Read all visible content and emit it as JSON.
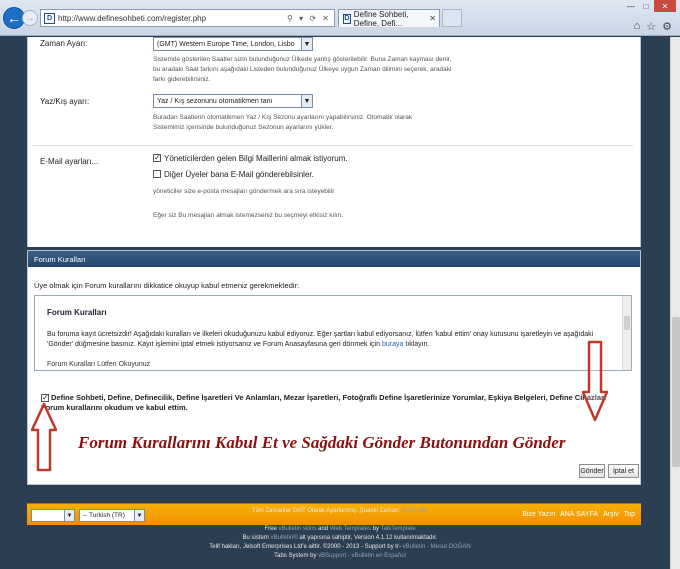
{
  "browser": {
    "url": "http://www.definesohbeti.com/register.php",
    "address_controls": "⚲ ▾ ⟳ ✕",
    "tab_title": "Define Sohbeti, Define, Defi...",
    "tab_close": "✕",
    "favicon": "D",
    "back": "←",
    "forward": "→",
    "window_controls": [
      "—",
      "□",
      "✕"
    ],
    "tool_icons": [
      "⌂",
      "☆",
      "⚙"
    ]
  },
  "settings": {
    "timezone_label": "Zaman Ayarı:",
    "timezone_value": "(GMT) Western Europe Time, London, Lisbo",
    "timezone_help": "Sistemde gösterilen Saatler sizin bulunduğunuz Ülkede yanlış gösterilebilir. Buna Zaman kayması denir, bu aradaki Saat farkını aşağıdaki Listeden bulunduğunuz Ülkeye uygun Zaman dilimini seçerek, aradaki farkı giderebilirsiniz.",
    "dst_label": "Yaz/Kış ayarı:",
    "dst_value": "Yaz / Kış sezonunu otomatikmen tanı",
    "dst_help": "Buradan Saatlerin otomatikmen Yaz / Kış Sezonu ayarlarını yapabilirsiniz. Otomatik olarak Sistemimiz içerisinde bulunduğunuz Sezonun ayarlarını yükler.",
    "email_label": "E-Mail ayarları...",
    "email_opt1": "Yöneticilerden gelen Bilgi Maillerini almak istiyorum.",
    "email_opt2": "Diğer Üyeler bana E-Mail gönderebilsinler.",
    "email_help1": "yöneticiler size e-posta mesajları göndermek ara sıra isteyebilir",
    "email_help2": "Eğer siz Bu mesajları almak istemezseniz bu seçmeyi etkisiz kılın."
  },
  "rules": {
    "header": "Forum Kuralları",
    "intro": "Üye olmak için Forum kurallarını dikkatice okuyup kabul etmeniz gerekmektedir:",
    "box_title": "Forum Kuralları",
    "box_body": "Bu foruma kayıt ücretsizdir! Aşağıdaki kuralları ve ilkeleri okuduğunuzu kabul ediyoruz. Eğer şartları kabul ediyorsanız, lütfen 'kabul ettim' onay kutusunu işaretleyin ve aşağıdaki 'Gönder' düğmesine basınız. Kayıt işlemini iptal etmek istiyorsanız ve Forum Anasayfasına geri dönmek için",
    "box_link": "buraya",
    "box_body_end": "tıklayın.",
    "box_sub": "Forum Kuralları Lütfen Okuyunuz",
    "agree_text": "Define Sohbeti, Define, Definecilik, Define İşaretleri Ve Anlamları, Mezar İşaretleri, Fotoğraflı Define İşaretlerinize Yorumlar, Eşkiya Belgeleri, Define Cihazları Forum kurallarını okudum ve kabul ettim."
  },
  "overlay_caption": "Forum Kurallarını Kabul Et ve Sağdaki Gönder Butonundan Gönder",
  "buttons": {
    "submit": "Gönder",
    "cancel": "İptal et"
  },
  "bottom_bar": {
    "style_select": "",
    "lang_select": "-- Turkish (TR)",
    "links": [
      "Bize Yazın",
      "ANA SAYFA",
      "Arşiv",
      "Top"
    ]
  },
  "footer": {
    "time_line": "Tüm Zamanlar GMT Olarak Ayarlanmış. Şuanki Zaman:",
    "time_value": "11:07 AM.",
    "credit1_pre": "Free",
    "credit1_a": "vBulletin skins",
    "credit1_mid": "and",
    "credit1_b": "Web Templates",
    "credit1_post": "by",
    "credit1_c": "TalkTemplate",
    "credit2_pre": "Bu sistem",
    "credit2_a": "vBulletin®",
    "credit2_post": "alt yapısına sahiptir, Version 4.1.12 kullanılmaktadır.",
    "credit3": "Telif hakları, Jelsoft Enterprises Ltd'e aittir. ©2000 - 2013 - Support by tr-",
    "credit3_a": "vBulletin",
    "credit3_b": "- Mesut DOĞAN",
    "credit4_pre": "Tabs System by",
    "credit4_a": "vBSupport",
    "credit4_b": "- vBulletin en Español"
  },
  "colors": {
    "page_bg": "#2c3e52",
    "accent_orange": "#f39a00",
    "arrow_red": "#c0392b",
    "caption": "#8b1010"
  }
}
